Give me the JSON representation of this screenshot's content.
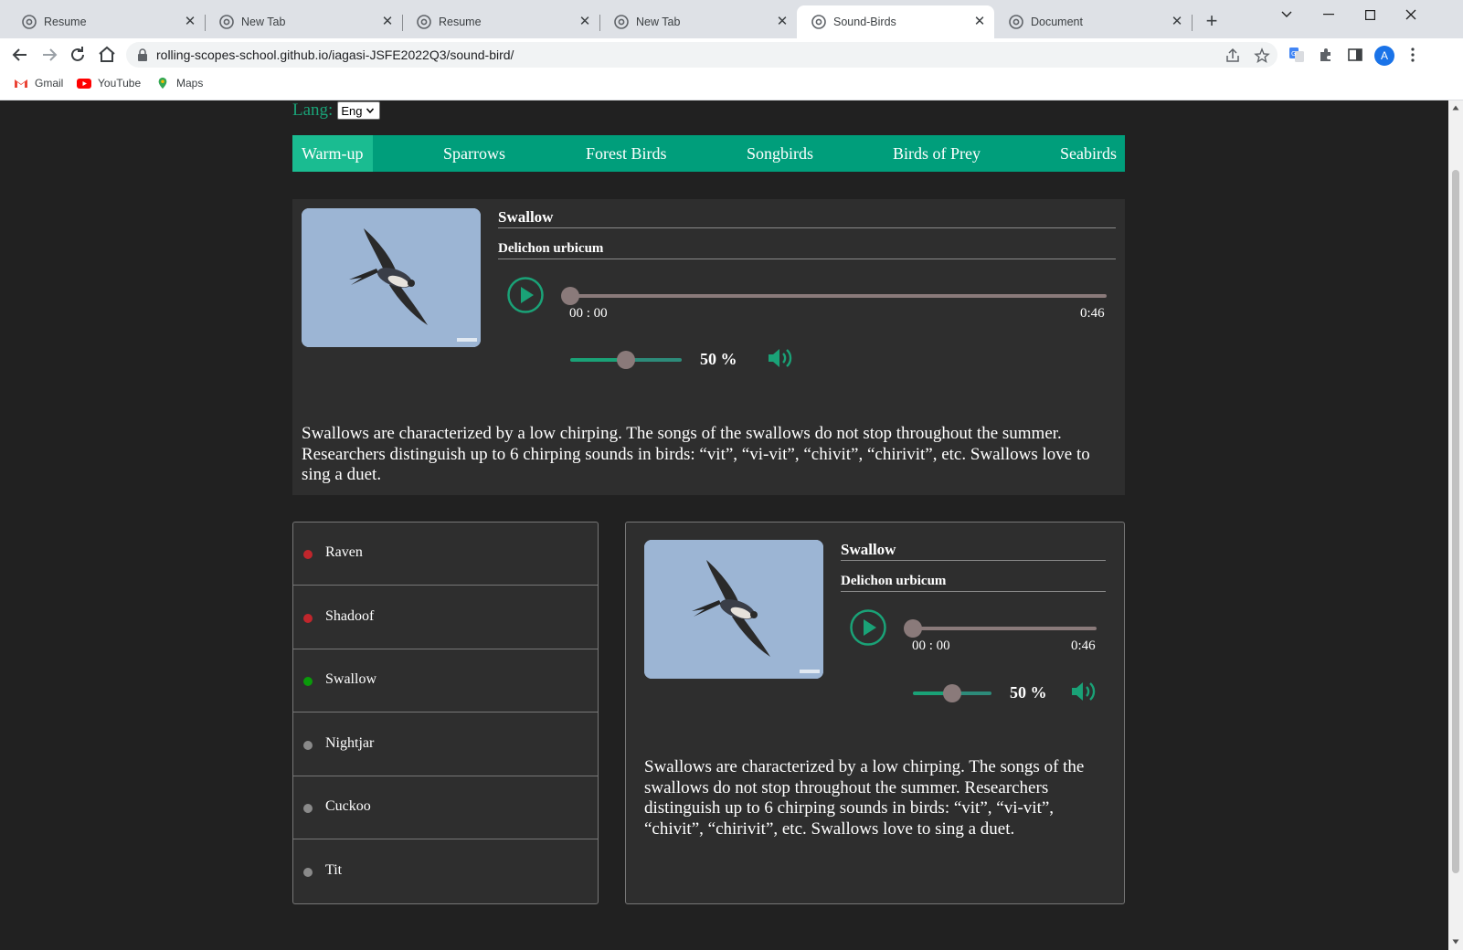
{
  "browser": {
    "tabs": [
      {
        "title": "Resume"
      },
      {
        "title": "New Tab"
      },
      {
        "title": "Resume"
      },
      {
        "title": "New Tab"
      },
      {
        "title": "Sound-Birds"
      },
      {
        "title": "Document"
      }
    ],
    "active_tab": 4,
    "url": "rolling-scopes-school.github.io/iagasi-JSFE2022Q3/sound-bird/",
    "bookmarks": [
      {
        "label": "Gmail"
      },
      {
        "label": "YouTube"
      },
      {
        "label": "Maps"
      }
    ],
    "profile_initial": "A"
  },
  "page": {
    "lang": {
      "label": "Lang:",
      "selected": "Eng"
    },
    "categories": [
      "Warm-up",
      "Sparrows",
      "Forest Birds",
      "Songbirds",
      "Birds of Prey",
      "Seabirds"
    ],
    "active_category": 0,
    "question": {
      "name": "Swallow",
      "latin": "Delichon urbicum",
      "time_current": "00 : 00",
      "time_total": "0:46",
      "progress": 0,
      "volume": 50,
      "volume_label": "50 %",
      "description": "Swallows are characterized by a low chirping. The songs of the swallows do not stop throughout the summer. Researchers distinguish up to 6 chirping sounds in birds: “vit”, “vi-vit”, “chivit”, “chirivit”, etc. Swallows love to sing a duet."
    },
    "answers": [
      {
        "label": "Raven",
        "status": "wrong",
        "color": "#c0262c"
      },
      {
        "label": "Shadoof",
        "status": "wrong",
        "color": "#c0262c"
      },
      {
        "label": "Swallow",
        "status": "correct",
        "color": "#0a9a0a"
      },
      {
        "label": "Nightjar",
        "status": "unanswered",
        "color": "#8a8a8a"
      },
      {
        "label": "Cuckoo",
        "status": "unanswered",
        "color": "#8a8a8a"
      },
      {
        "label": "Tit",
        "status": "unanswered",
        "color": "#8a8a8a"
      }
    ],
    "info": {
      "name": "Swallow",
      "latin": "Delichon urbicum",
      "time_current": "00 : 00",
      "time_total": "0:46",
      "progress": 0,
      "volume": 50,
      "volume_label": "50 %",
      "description": "Swallows are characterized by a low chirping. The songs of the swallows do not stop throughout the summer. Researchers distinguish up to 6 chirping sounds in birds: “vit”, “vi-vit”, “chivit”, “chirivit”, etc. Swallows love to sing a duet."
    },
    "colors": {
      "accent": "#009e7b",
      "accent_active": "#1abc91",
      "background": "#212121",
      "panel": "#2e2e2e"
    }
  }
}
